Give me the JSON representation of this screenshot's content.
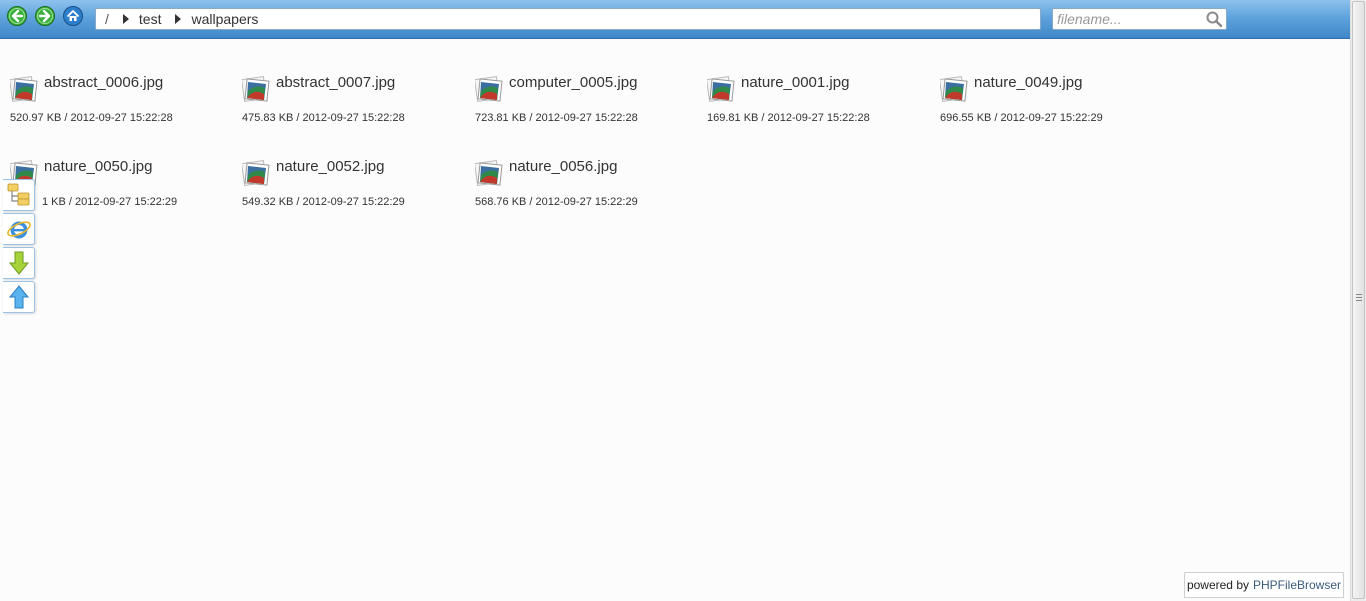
{
  "toolbar": {
    "breadcrumb": {
      "root": "/",
      "items": [
        "test",
        "wallpapers"
      ]
    },
    "search": {
      "placeholder": "filename..."
    }
  },
  "files": [
    {
      "name": "abstract_0006.jpg",
      "meta": "520.97 KB / 2012-09-27 15:22:28"
    },
    {
      "name": "abstract_0007.jpg",
      "meta": "475.83 KB / 2012-09-27 15:22:28"
    },
    {
      "name": "computer_0005.jpg",
      "meta": "723.81 KB / 2012-09-27 15:22:28"
    },
    {
      "name": "nature_0001.jpg",
      "meta": "169.81 KB / 2012-09-27 15:22:28"
    },
    {
      "name": "nature_0049.jpg",
      "meta": "696.55 KB / 2012-09-27 15:22:29"
    },
    {
      "name": "nature_0050.jpg",
      "meta": "1 KB / 2012-09-27 15:22:29"
    },
    {
      "name": "nature_0052.jpg",
      "meta": "549.32 KB / 2012-09-27 15:22:29"
    },
    {
      "name": "nature_0056.jpg",
      "meta": "568.76 KB / 2012-09-27 15:22:29"
    }
  ],
  "footer": {
    "powered_prefix": "powered by",
    "powered_link": "PHPFileBrowser"
  },
  "icons": {
    "back": "back-arrow-icon",
    "forward": "forward-arrow-icon",
    "home": "home-icon",
    "search": "search-icon",
    "file": "image-file-icon",
    "side": [
      "folder-tree-icon",
      "internet-explorer-icon",
      "download-icon",
      "upload-icon"
    ]
  },
  "colors": {
    "toolbar": "#5fa3dc",
    "nav_button": "#3cae3c"
  }
}
